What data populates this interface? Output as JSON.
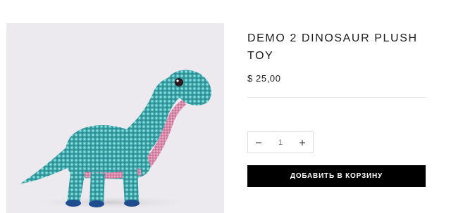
{
  "product": {
    "title": "DEMO 2 DINOSAUR PLUSH TOY",
    "price": "$ 25,00",
    "image_alt": "sequin dinosaur plush toy"
  },
  "quantity": {
    "value": "1",
    "decrease_icon": "minus-icon",
    "increase_icon": "plus-icon"
  },
  "actions": {
    "add_to_cart_label": "ДОБАВИТЬ В КОРЗИНУ"
  },
  "colors": {
    "button_bg": "#000000",
    "button_text": "#ffffff",
    "photo_bg": "#eceaee",
    "sequin_teal": "#3fa3a6",
    "belly_pink": "#d68aa6"
  }
}
